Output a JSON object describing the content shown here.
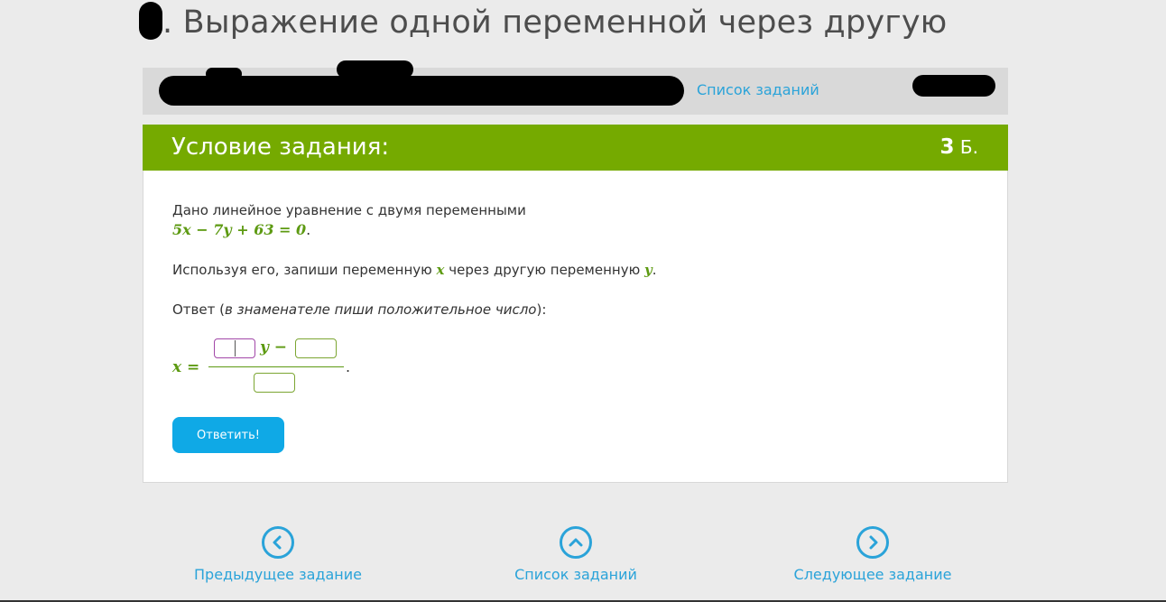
{
  "page": {
    "title": ". Выражение одной переменной через другую"
  },
  "topbar": {
    "task_list_link": "Список заданий"
  },
  "task": {
    "header_title": "Условие задания:",
    "points_value": "3",
    "points_unit": " Б.",
    "line1": "Дано линейное уравнение с двумя переменными",
    "equation": "5x − 7y + 63 = 0",
    "equation_end": ".",
    "line2_before": "Используя его, запиши переменную ",
    "line2_var_x": "x",
    "line2_mid": " через другую переменную ",
    "line2_var_y": "y",
    "line2_end": ".",
    "answer_prefix": "Ответ (",
    "answer_hint": "в знаменателе пиши положительное число",
    "answer_suffix": "):",
    "fraction_lhs": "x =",
    "fraction_y_minus": "y −",
    "fraction_end": ".",
    "submit_label": "Ответить!"
  },
  "nav": {
    "prev_label": "Предыдущее задание",
    "list_label": "Список заданий",
    "next_label": "Следующее задание"
  },
  "colors": {
    "accent_green": "#75aa00",
    "link_blue": "#2aa3d9",
    "button_blue": "#0fa9e6",
    "math_green": "#5d9a12"
  }
}
